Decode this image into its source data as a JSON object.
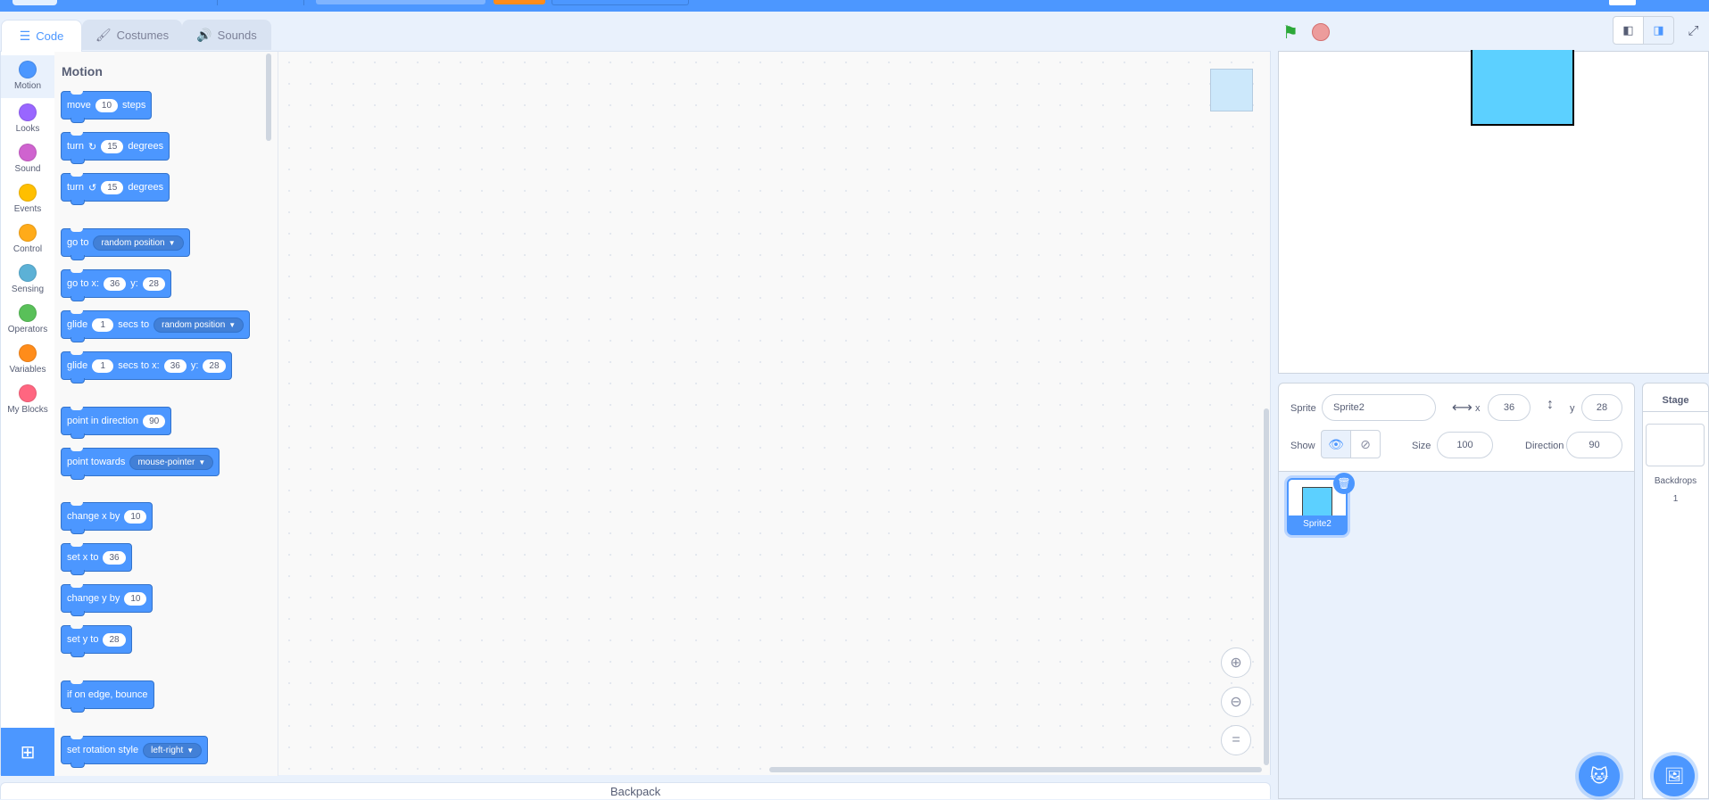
{
  "tabs": [
    {
      "label": "Code",
      "icon": "code-icon"
    },
    {
      "label": "Costumes",
      "icon": "brush-icon"
    },
    {
      "label": "Sounds",
      "icon": "speaker-icon"
    }
  ],
  "categories": [
    {
      "label": "Motion",
      "color": "#4c97ff"
    },
    {
      "label": "Looks",
      "color": "#9966ff"
    },
    {
      "label": "Sound",
      "color": "#cf63cf"
    },
    {
      "label": "Events",
      "color": "#ffbf00"
    },
    {
      "label": "Control",
      "color": "#ffab19"
    },
    {
      "label": "Sensing",
      "color": "#5cb1d6"
    },
    {
      "label": "Operators",
      "color": "#59c059"
    },
    {
      "label": "Variables",
      "color": "#ff8c1a"
    },
    {
      "label": "My Blocks",
      "color": "#ff6680"
    }
  ],
  "palette": {
    "section_title": "Motion",
    "blocks": {
      "move": {
        "pre": "move",
        "val": "10",
        "post": "steps"
      },
      "turn_right": {
        "pre": "turn",
        "val": "15",
        "post": "degrees"
      },
      "turn_left": {
        "pre": "turn",
        "val": "15",
        "post": "degrees"
      },
      "goto": {
        "pre": "go to",
        "drop": "random position"
      },
      "goto_xy": {
        "pre": "go to x:",
        "x": "36",
        "mid": "y:",
        "y": "28"
      },
      "glide_to": {
        "pre": "glide",
        "val": "1",
        "mid": "secs to",
        "drop": "random position"
      },
      "glide_xy": {
        "pre": "glide",
        "val": "1",
        "mid": "secs to x:",
        "x": "36",
        "mid2": "y:",
        "y": "28"
      },
      "point_dir": {
        "pre": "point in direction",
        "val": "90"
      },
      "point_towards": {
        "pre": "point towards",
        "drop": "mouse-pointer"
      },
      "change_x": {
        "pre": "change x by",
        "val": "10"
      },
      "set_x": {
        "pre": "set x to",
        "val": "36"
      },
      "change_y": {
        "pre": "change y by",
        "val": "10"
      },
      "set_y": {
        "pre": "set y to",
        "val": "28"
      },
      "bounce": {
        "pre": "if on edge, bounce"
      },
      "rotation_style": {
        "pre": "set rotation style",
        "drop": "left-right"
      }
    }
  },
  "backpack_label": "Backpack",
  "sprite_info": {
    "sprite_label": "Sprite",
    "sprite_name": "Sprite2",
    "x_label": "x",
    "x_value": "36",
    "y_label": "y",
    "y_value": "28",
    "show_label": "Show",
    "size_label": "Size",
    "size_value": "100",
    "direction_label": "Direction",
    "direction_value": "90"
  },
  "sprites": [
    {
      "name": "Sprite2",
      "color": "#5cd0ff"
    }
  ],
  "stage_panel": {
    "title": "Stage",
    "backdrops_label": "Backdrops",
    "backdrops_count": "1"
  }
}
